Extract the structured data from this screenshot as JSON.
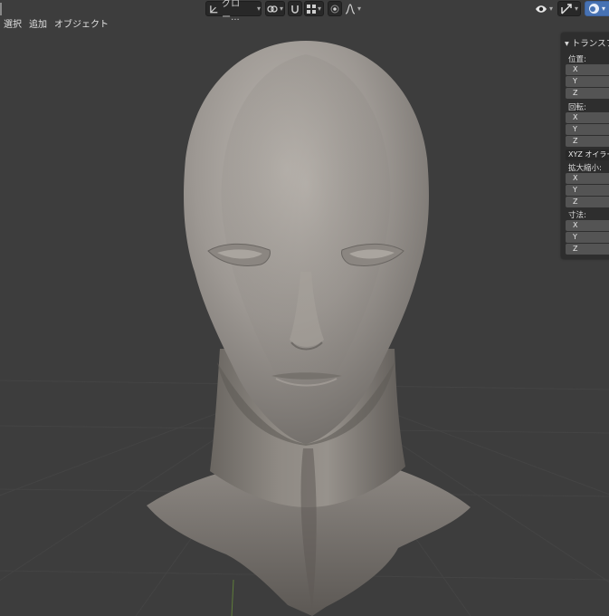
{
  "header": {
    "transform_orientation": "グロー..."
  },
  "menu": [
    "選択",
    "追加",
    "オブジェクト"
  ],
  "transform_panel": {
    "title": "▾ トランスフ",
    "location_label": "位置:",
    "location_axes": [
      "X",
      "Y",
      "Z"
    ],
    "rotation_label": "回転:",
    "rotation_axes": [
      "X",
      "Y",
      "Z"
    ],
    "rotation_mode": "XYZ オイラー",
    "scale_label": "拡大縮小:",
    "scale_axes": [
      "X",
      "Y",
      "Z"
    ],
    "dimensions_label": "寸法:",
    "dimensions_axes": [
      "X",
      "Y",
      "Z"
    ]
  },
  "colors": {
    "viewport_bg": "#3d3d3d",
    "panel_bg": "#2e2e2e",
    "field_bg": "#545454",
    "header_button": "#282828",
    "active_blue": "#4772b3",
    "model_clay": "#8f8b86"
  },
  "icons": [
    "transform-pivot-icon",
    "snap-link-icon",
    "snap-magnet-icon",
    "snap-grid-icon",
    "proportional-edit-icon",
    "falloff-curve-icon",
    "visibility-eye-icon",
    "gizmo-icon",
    "overlay-icon"
  ]
}
